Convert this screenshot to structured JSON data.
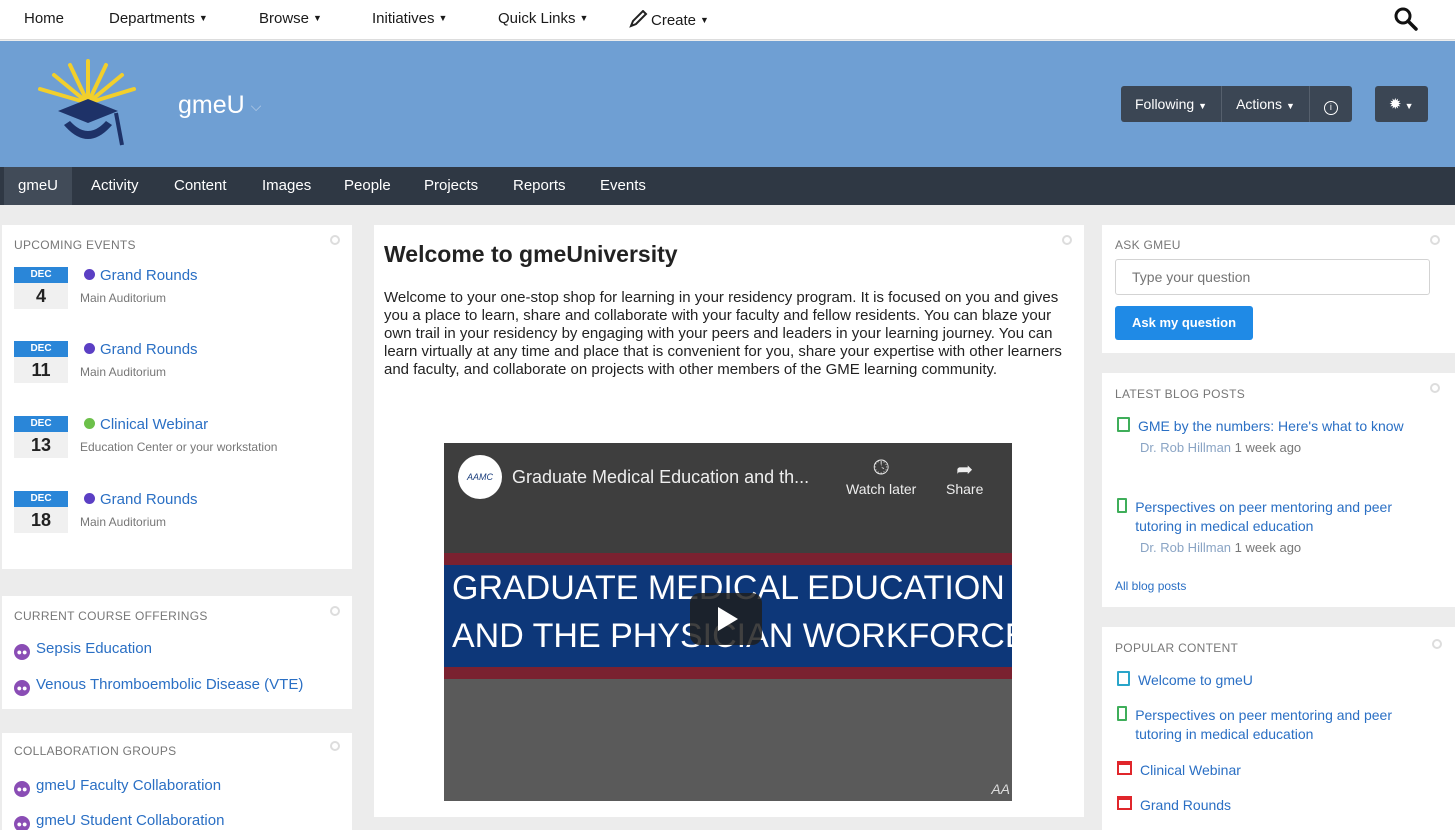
{
  "topnav": {
    "items": [
      "Home",
      "Departments",
      "Browse",
      "Initiatives",
      "Quick Links",
      "Create"
    ]
  },
  "banner": {
    "place_title": "gmeU",
    "buttons": [
      "Following",
      "Actions"
    ]
  },
  "tabs": [
    "gmeU",
    "Activity",
    "Content",
    "Images",
    "People",
    "Projects",
    "Reports",
    "Events"
  ],
  "events": {
    "heading": "UPCOMING EVENTS",
    "items": [
      {
        "month": "DEC",
        "day": "4",
        "title": "Grand Rounds",
        "location": "Main Auditorium",
        "dot": "#5b3fc4"
      },
      {
        "month": "DEC",
        "day": "11",
        "title": "Grand Rounds",
        "location": "Main Auditorium",
        "dot": "#5b3fc4"
      },
      {
        "month": "DEC",
        "day": "13",
        "title": "Clinical Webinar",
        "location": "Education Center or your workstation",
        "dot": "#6cc04a"
      },
      {
        "month": "DEC",
        "day": "18",
        "title": "Grand Rounds",
        "location": "Main Auditorium",
        "dot": "#5b3fc4"
      }
    ]
  },
  "courses": {
    "heading": "CURRENT COURSE OFFERINGS",
    "items": [
      "Sepsis Education",
      "Venous Thromboembolic Disease (VTE)"
    ]
  },
  "groups": {
    "heading": "COLLABORATION GROUPS",
    "items": [
      "gmeU Faculty Collaboration",
      "gmeU Student Collaboration"
    ]
  },
  "welcome": {
    "title": "Welcome to gmeUniversity",
    "body": "Welcome to your one-stop shop for learning in your residency program. It is focused on you and gives you a place to learn, share and collaborate with your faculty and fellow residents. You can blaze your own trail in your residency by engaging with your peers and leaders in your learning journey. You can learn virtually at any time and place that is convenient for you, share your expertise with other learners and faculty, and collaborate on projects with other members of the GME learning community."
  },
  "video": {
    "channel": "AAMC",
    "title": "Graduate Medical Education and th...",
    "watch_later": "Watch later",
    "share": "Share",
    "line1": "GRADUATE MEDICAL EDUCATION",
    "line2": "AND THE PHYSICIAN WORKFORCE",
    "watermark": "AA"
  },
  "ask": {
    "heading": "ASK GMEU",
    "placeholder": "Type your question",
    "button": "Ask my question"
  },
  "blog": {
    "heading": "LATEST BLOG POSTS",
    "items": [
      {
        "title": "GME by the numbers: Here's what to know",
        "author": "Dr. Rob Hillman",
        "time": "1 week ago"
      },
      {
        "title": "Perspectives on peer mentoring and peer tutoring in medical education",
        "author": "Dr. Rob Hillman",
        "time": "1 week ago"
      }
    ],
    "all_link": "All blog posts"
  },
  "popular": {
    "heading": "POPULAR CONTENT",
    "items": [
      {
        "title": "Welcome to gmeU",
        "icon": "document-icon"
      },
      {
        "title": "Perspectives on peer mentoring and peer tutoring in medical education",
        "icon": "blog-icon"
      },
      {
        "title": "Clinical Webinar",
        "icon": "event-icon"
      },
      {
        "title": "Grand Rounds",
        "icon": "event-icon"
      }
    ]
  }
}
